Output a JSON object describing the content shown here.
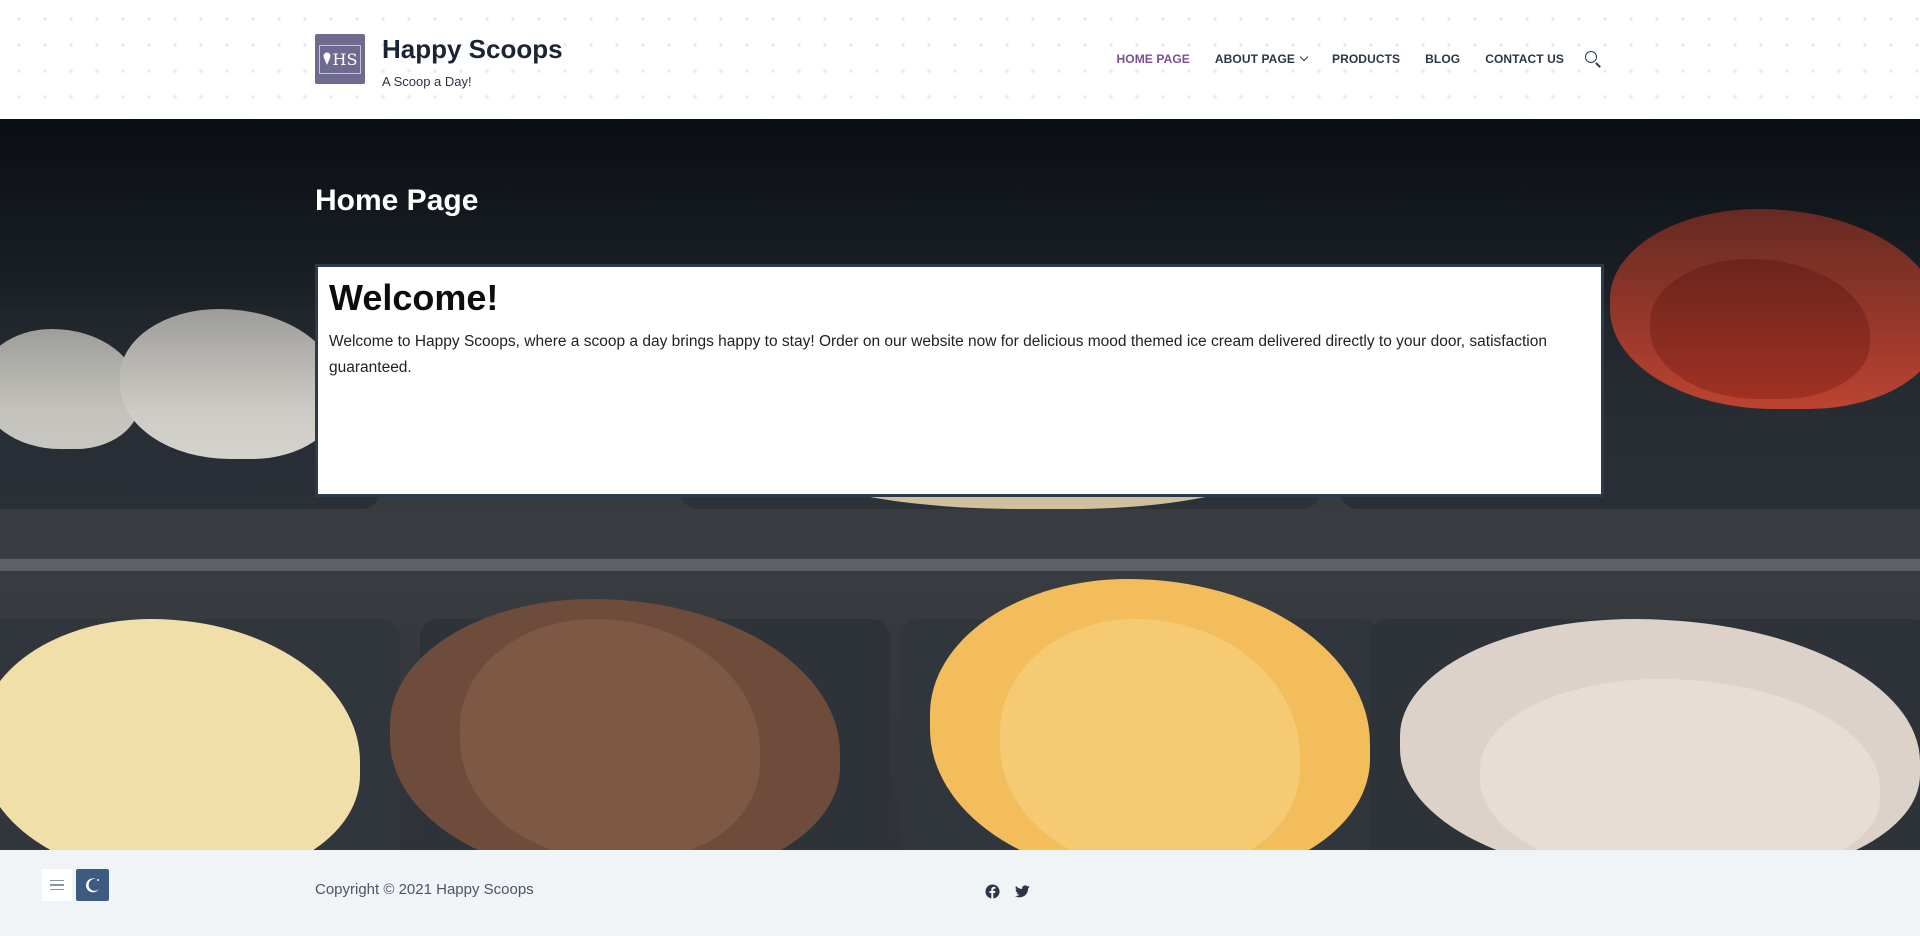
{
  "header": {
    "logo_text": "HS",
    "title": "Happy Scoops",
    "tagline": "A Scoop a Day!"
  },
  "nav": {
    "items": [
      {
        "label": "HOME PAGE",
        "active": true
      },
      {
        "label": "ABOUT PAGE",
        "has_dropdown": true
      },
      {
        "label": "PRODUCTS"
      },
      {
        "label": "BLOG"
      },
      {
        "label": "CONTACT US"
      }
    ],
    "search_icon": "search-icon"
  },
  "main": {
    "page_title": "Home Page",
    "welcome_heading": "Welcome!",
    "welcome_text": "Welcome to Happy Scoops, where a scoop a day brings happy to stay! Order on our website now for delicious mood themed ice cream delivered directly to your door, satisfaction guaranteed."
  },
  "footer": {
    "copyright": "Copyright © 2021 Happy Scoops",
    "social_icons": [
      "facebook-icon",
      "twitter-icon"
    ],
    "tools": [
      "menu-icon",
      "dark-mode-icon"
    ]
  },
  "colors": {
    "accent": "#7a4f95",
    "nav_text": "#2c3646",
    "logo_bg": "#6f6a90",
    "box_border": "#2b3a4d",
    "dark_toggle": "#3d5b80",
    "footer_bg": "#f1f4f7"
  }
}
